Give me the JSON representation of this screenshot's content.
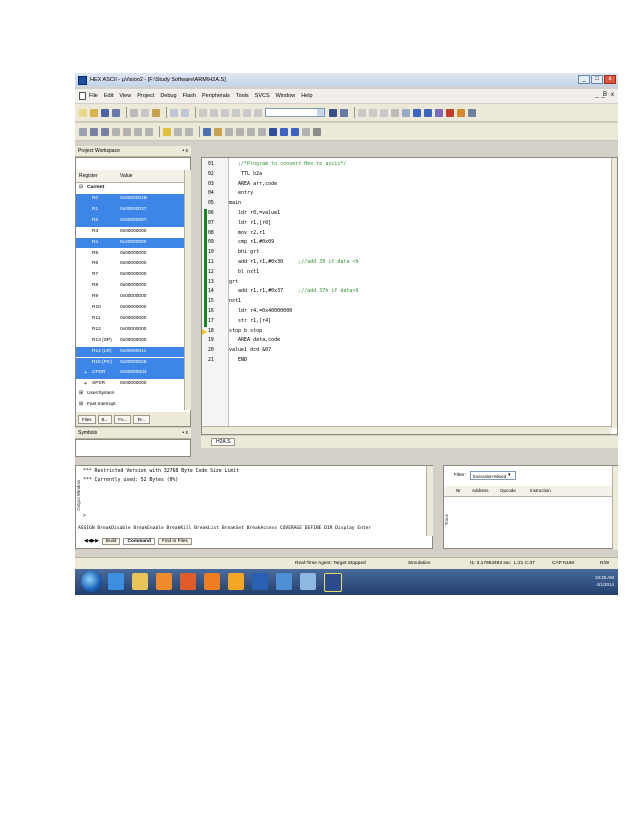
{
  "window": {
    "title": "HEX ASCII - µVision2 - [F:\\Study Software\\ARM\\H2A.S]",
    "min": "_",
    "max": "□",
    "close": "x"
  },
  "menu": {
    "items": [
      "File",
      "Edit",
      "View",
      "Project",
      "Debug",
      "Flash",
      "Peripherals",
      "Tools",
      "SVCS",
      "Window",
      "Help"
    ],
    "mdi": [
      "_",
      "̲B",
      "x"
    ]
  },
  "project": {
    "title": "Project Workspace",
    "close": "• x",
    "col_register": "Register",
    "col_value": "Value",
    "group": "Current",
    "registers": [
      {
        "name": "R0",
        "value": "0x0000001B",
        "selected": true
      },
      {
        "name": "R1",
        "value": "0x00000037",
        "selected": true
      },
      {
        "name": "R2",
        "value": "0x00000007",
        "selected": true
      },
      {
        "name": "R3",
        "value": "0x00000000",
        "selected": false
      },
      {
        "name": "R4",
        "value": "0x40000000",
        "selected": true
      },
      {
        "name": "R5",
        "value": "0x00000000",
        "selected": false
      },
      {
        "name": "R6",
        "value": "0x00000000",
        "selected": false
      },
      {
        "name": "R7",
        "value": "0x00000000",
        "selected": false
      },
      {
        "name": "R8",
        "value": "0x00000000",
        "selected": false
      },
      {
        "name": "R9",
        "value": "0x00000000",
        "selected": false
      },
      {
        "name": "R10",
        "value": "0x00000000",
        "selected": false
      },
      {
        "name": "R11",
        "value": "0x00000000",
        "selected": false
      },
      {
        "name": "R12",
        "value": "0x00000000",
        "selected": false
      },
      {
        "name": "R13 (SP)",
        "value": "0x00000000",
        "selected": false
      },
      {
        "name": "R14 (LR)",
        "value": "0x0000001c",
        "selected": true
      },
      {
        "name": "R15 (PC)",
        "value": "0x00000028",
        "selected": true
      },
      {
        "name": "CPSR",
        "value": "0x000000d3",
        "selected": true,
        "expand": "+"
      },
      {
        "name": "SPSR",
        "value": "0x00000000",
        "selected": false,
        "expand": "+"
      }
    ],
    "extra": [
      "User/System",
      "Fast Interrupt"
    ],
    "tabs": [
      "Files",
      "B...",
      "Fu...",
      "Te..."
    ]
  },
  "symbols": {
    "title": "Symbols",
    "close": "• x"
  },
  "editor": {
    "tab": "H2A.S",
    "lines": [
      {
        "n": "01",
        "code": "   ;/*Program to convert Hex to ascii*/",
        "comment": ""
      },
      {
        "n": "02",
        "code": "    TTL h2a",
        "comment": ""
      },
      {
        "n": "03",
        "code": "   AREA arr,code",
        "comment": ""
      },
      {
        "n": "04",
        "code": "   entry",
        "comment": ""
      },
      {
        "n": "05",
        "code": "main",
        "comment": ""
      },
      {
        "n": "06",
        "code": "   ldr r0,=value1",
        "comment": ""
      },
      {
        "n": "07",
        "code": "   ldr r1,[r0]",
        "comment": ""
      },
      {
        "n": "08",
        "code": "   mov r2,r1",
        "comment": ""
      },
      {
        "n": "09",
        "code": "   cmp r1,#0x09",
        "comment": ""
      },
      {
        "n": "10",
        "code": "   bhi grt",
        "comment": ""
      },
      {
        "n": "11",
        "code": "   add r1,r1,#0x30",
        "comment": "     ;//add 30 if data <9"
      },
      {
        "n": "12",
        "code": "   bl nxt1",
        "comment": ""
      },
      {
        "n": "13",
        "code": "grt",
        "comment": ""
      },
      {
        "n": "14",
        "code": "   add r1,r1,#0x37",
        "comment": "     ;//add 37h if data>9"
      },
      {
        "n": "15",
        "code": "nxt1",
        "comment": ""
      },
      {
        "n": "16",
        "code": "   ldr r4,=0x40000000",
        "comment": ""
      },
      {
        "n": "17",
        "code": "   str r1,[r4]",
        "comment": ""
      },
      {
        "n": "18",
        "code": "stop b stop",
        "comment": ""
      },
      {
        "n": "19",
        "code": "   AREA data,code",
        "comment": ""
      },
      {
        "n": "20",
        "code": "value1 dcd &07",
        "comment": ""
      },
      {
        "n": "21",
        "code": "   END",
        "comment": ""
      }
    ]
  },
  "output": {
    "label": "Output Window",
    "lines": [
      "*** Restricted Version with 32768 Byte Code Size Limit",
      "*** Currently used: 52 Bytes (0%)",
      "",
      ">",
      "ASSIGN BreakDisable BreakEnable BreakKill BreakList BreakSet BreakAccess COVERAGE DEFINE DIR Display Enter"
    ],
    "tabs": [
      "Build",
      "Command",
      "Find in Files"
    ]
  },
  "trace": {
    "label": "Trace",
    "filter_label": "Filter:",
    "filter_value": "Execution-Mixed",
    "cols": [
      "Nr",
      "Address",
      "Opcode",
      "Instruction"
    ]
  },
  "status": {
    "agent": "Real-Time Agent: Target Stopped",
    "mode": "Simulation",
    "time": "t1: 3.17953493 sec",
    "pos": "L:21 C:37",
    "caps": "CAP  NUM",
    "rw": "R/W"
  },
  "taskbar": {
    "time": "10:25 AM",
    "date": "4/1/2014"
  },
  "colors": {
    "selection": "#3d86e8",
    "marker": "#118a1f",
    "comment": "#2f8f2f"
  }
}
